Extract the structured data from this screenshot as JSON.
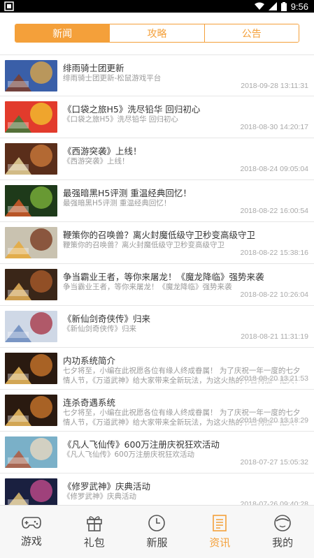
{
  "status_bar": {
    "time": "9:56"
  },
  "tabs": [
    {
      "label": "新闻",
      "active": true
    },
    {
      "label": "攻略",
      "active": false
    },
    {
      "label": "公告",
      "active": false
    }
  ],
  "colors": {
    "accent": "#f4a03a",
    "title": "#333333",
    "muted": "#9a9a9a"
  },
  "articles": [
    {
      "title": "绯雨骑士团更新",
      "subtitle": "绯雨骑士团更新-松鼠游戏平台",
      "date": "2018-09-28 13:11:31"
    },
    {
      "title": "《口袋之旅H5》洗尽铅华 回归初心",
      "subtitle": "《口袋之旅H5》洗尽铅华 回归初心",
      "date": "2018-08-30 14:20:17"
    },
    {
      "title": "《西游突袭》上线！",
      "subtitle": "《西游突袭》上线！",
      "date": "2018-08-24 09:05:04"
    },
    {
      "title": "最强暗黑H5评测 重温经典回忆！",
      "subtitle": "最强暗黑H5评测 重温经典回忆！",
      "date": "2018-08-22 16:00:54"
    },
    {
      "title": "鞭策你的召唤兽？离火封魔低级守卫秒变高级守卫",
      "subtitle": "鞭策你的召唤兽？离火封魔低级守卫秒变高级守卫",
      "date": "2018-08-22 15:38:16"
    },
    {
      "title": "争当霸业王者，等你来屠龙！《魔龙降临》强势来袭",
      "subtitle": "争当霸业王者，等你来屠龙！《魔龙降临》强势来袭",
      "date": "2018-08-22 10:26:04"
    },
    {
      "title": "《新仙剑奇侠传》归来",
      "subtitle": "《新仙剑奇侠传》归来",
      "date": "2018-08-21 11:31:19"
    },
    {
      "title": "内功系统简介",
      "subtitle": "七夕将至，小编在此祝愿各位有缘人终成眷属！ 为了庆祝一年一度的七夕情人节，《万道武神》给大家带来全新玩法，为这火热的节日再加一把火！",
      "date": "2018-08-20 13:21:53"
    },
    {
      "title": "连杀奇遇系统",
      "subtitle": "七夕将至，小编在此祝愿各位有缘人终成眷属！ 为了庆祝一年一度的七夕情人节，《万道武神》给大家带来全新玩法，为这火热的节日再加一把火！",
      "date": "2018-08-20 13:18:29"
    },
    {
      "title": "《凡人飞仙传》600万注册庆祝狂欢活动",
      "subtitle": "《凡人飞仙传》600万注册庆祝狂欢活动",
      "date": "2018-07-27 15:05:32"
    },
    {
      "title": "《修罗武神》庆典活动",
      "subtitle": "《修罗武神》庆典活动",
      "date": "2018-07-26 09:40:28"
    }
  ],
  "bottom_nav": [
    {
      "label": "游戏",
      "icon": "gamepad-icon",
      "active": false
    },
    {
      "label": "礼包",
      "icon": "gift-icon",
      "active": false
    },
    {
      "label": "新服",
      "icon": "clock-icon",
      "active": false
    },
    {
      "label": "资讯",
      "icon": "news-icon",
      "active": true
    },
    {
      "label": "我的",
      "icon": "profile-icon",
      "active": false
    }
  ]
}
